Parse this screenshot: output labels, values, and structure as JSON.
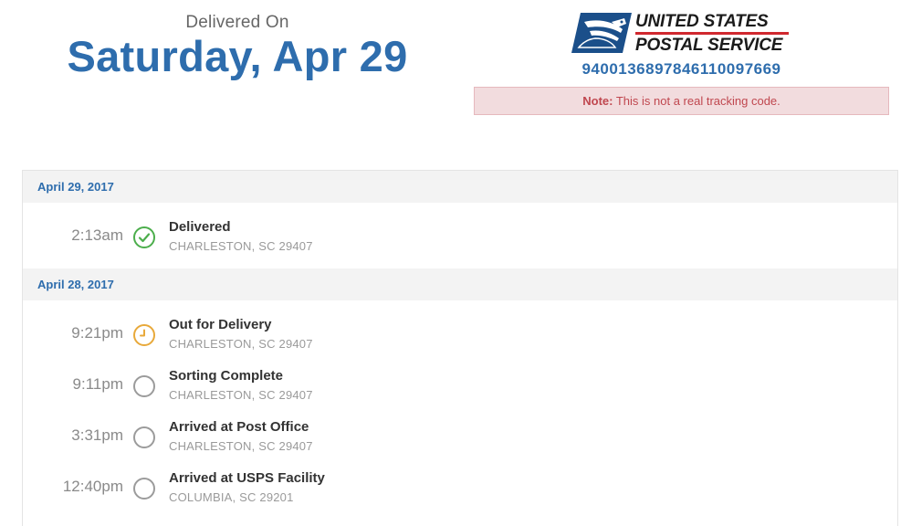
{
  "delivery": {
    "label": "Delivered On",
    "date": "Saturday, Apr 29"
  },
  "brand": {
    "line1": "UNITED STATES",
    "line2": "POSTAL SERVICE",
    "colors": {
      "blue": "#1b4f8a",
      "red": "#d0282e"
    }
  },
  "tracking": {
    "number": "9400136897846110097669",
    "note_label": "Note:",
    "note_text": "This is not a real tracking code."
  },
  "days": [
    {
      "date": "April 29, 2017",
      "events": [
        {
          "time": "2:13am",
          "status": "Delivered",
          "location": "CHARLESTON, SC 29407",
          "icon": "check-circle-icon",
          "color": "#4cae4c"
        }
      ]
    },
    {
      "date": "April 28, 2017",
      "events": [
        {
          "time": "9:21pm",
          "status": "Out for Delivery",
          "location": "CHARLESTON, SC 29407",
          "icon": "clock-icon",
          "color": "#e8a93a"
        },
        {
          "time": "9:11pm",
          "status": "Sorting Complete",
          "location": "CHARLESTON, SC 29407",
          "icon": "circle-icon",
          "color": "#9b9b9b"
        },
        {
          "time": "3:31pm",
          "status": "Arrived at Post Office",
          "location": "CHARLESTON, SC 29407",
          "icon": "circle-icon",
          "color": "#9b9b9b"
        },
        {
          "time": "12:40pm",
          "status": "Arrived at USPS Facility",
          "location": "COLUMBIA, SC 29201",
          "icon": "circle-icon",
          "color": "#9b9b9b"
        }
      ]
    }
  ]
}
